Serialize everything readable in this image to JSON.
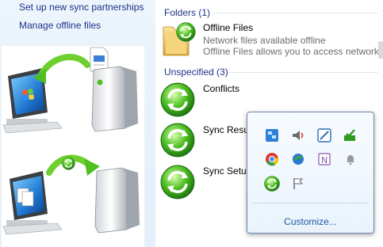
{
  "tasks": [
    {
      "label": "Set up new sync partnerships"
    },
    {
      "label": "Manage offline files"
    }
  ],
  "groups": [
    {
      "header": "Folders (1)",
      "items": [
        {
          "title": "Offline Files",
          "lines": [
            "Network files available offline",
            "Offline Files allows you to access network fil"
          ]
        }
      ]
    },
    {
      "header": "Unspecified (3)",
      "items": [
        {
          "title": "Conflicts"
        },
        {
          "title": "Sync Resul"
        },
        {
          "title": "Sync Setup"
        }
      ]
    }
  ],
  "tray_popup": {
    "icons": [
      "network-icon",
      "volume-icon",
      "snipping-tool-icon",
      "safely-remove-hardware-icon",
      "chrome-icon",
      "network-globe-icon",
      "onenote-icon",
      "notification-bell-icon",
      "sync-center-icon",
      "action-center-flag-icon"
    ],
    "customize_label": "Customize..."
  },
  "colors": {
    "link": "#1e3287",
    "sync_green": "#2c9a1d",
    "folder_yellow": "#e8c15a"
  }
}
